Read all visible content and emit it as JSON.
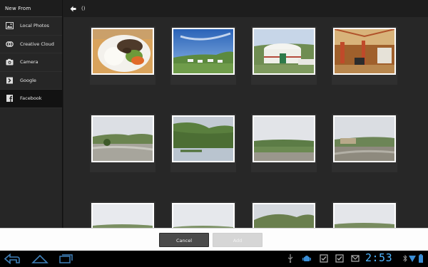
{
  "sidebar": {
    "title": "New From",
    "items": [
      {
        "label": "Local Photos",
        "icon": "photo-icon"
      },
      {
        "label": "Creative Cloud",
        "icon": "creative-cloud-icon"
      },
      {
        "label": "Camera",
        "icon": "camera-icon"
      },
      {
        "label": "Google",
        "icon": "google-icon"
      },
      {
        "label": "Facebook",
        "icon": "facebook-icon",
        "active": true
      }
    ]
  },
  "topbar": {
    "path": "()"
  },
  "photos": [
    {
      "subject": "plate of food"
    },
    {
      "subject": "blue sky over green hills with tents"
    },
    {
      "subject": "white yurt on grass"
    },
    {
      "subject": "yurt interior"
    },
    {
      "subject": "flooded river valley"
    },
    {
      "subject": "river valley with hills"
    },
    {
      "subject": "river and grassland"
    },
    {
      "subject": "river with buildings"
    },
    {
      "subject": "cloudy sky over hills"
    },
    {
      "subject": "cloudy sky over hills"
    },
    {
      "subject": "green hills"
    },
    {
      "subject": "green hills"
    }
  ],
  "actions": {
    "cancel_label": "Cancel",
    "add_label": "Add",
    "add_enabled": false
  },
  "statusbar": {
    "time": "2:53"
  },
  "colors": {
    "accent": "#4fb6ff",
    "sidebar_active": "#121212",
    "grid_bg": "#272727"
  }
}
